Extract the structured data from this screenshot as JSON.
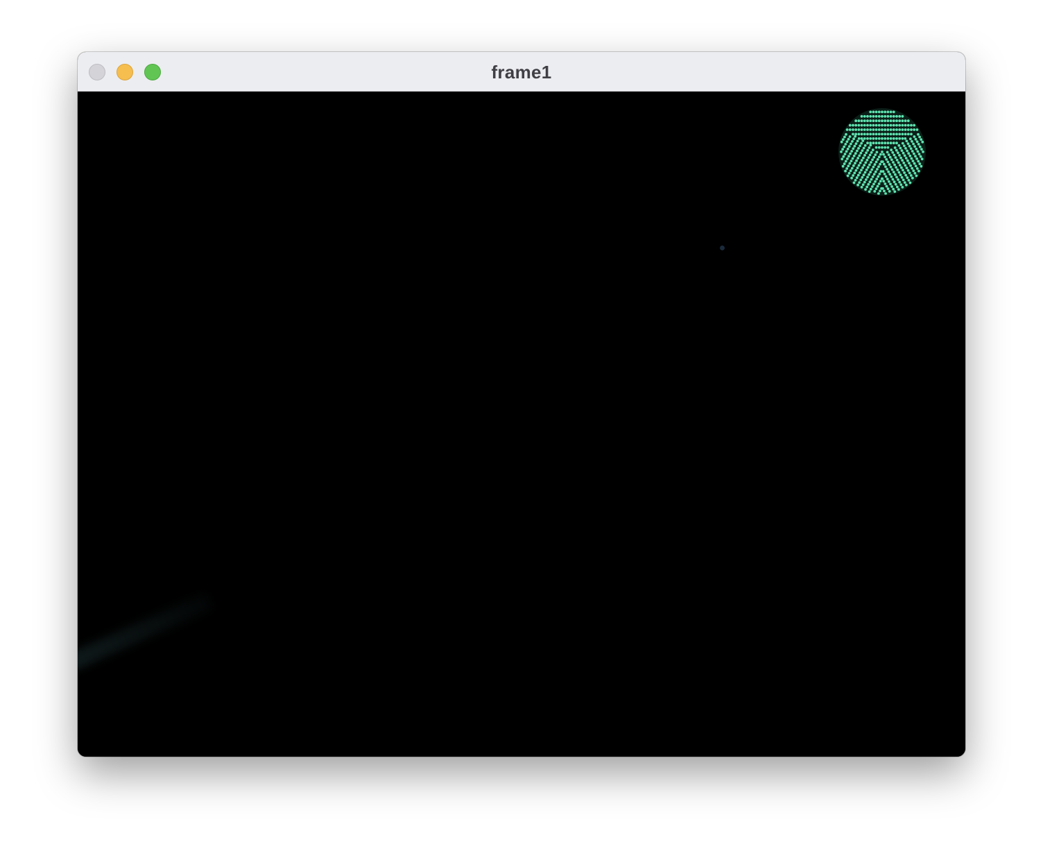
{
  "window": {
    "title": "frame1"
  },
  "controls": {
    "close": "close-icon",
    "minimize": "minimize-icon",
    "zoom": "zoom-icon"
  },
  "colors": {
    "led": "#5fe3b0",
    "background": "#000000",
    "titlebar": "#ecedf0"
  }
}
